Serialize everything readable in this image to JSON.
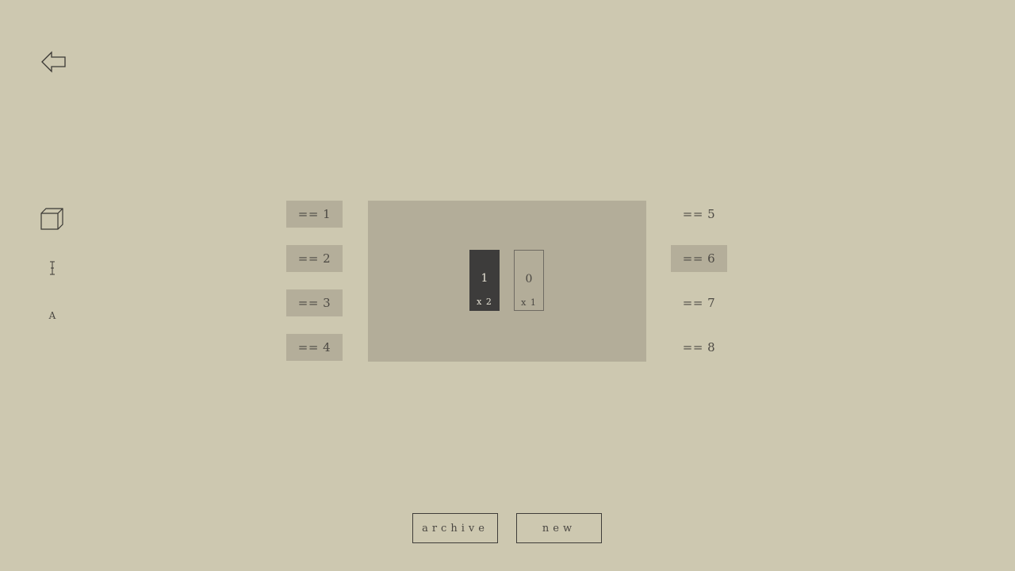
{
  "toolbar": {
    "back_icon": "back-arrow-icon",
    "cube_icon": "cube-icon",
    "cursor_icon": "text-cursor-icon",
    "letter_label": "A"
  },
  "slots_left": [
    {
      "label": "== 1",
      "filled": true
    },
    {
      "label": "== 2",
      "filled": true
    },
    {
      "label": "== 3",
      "filled": true
    },
    {
      "label": "== 4",
      "filled": true
    }
  ],
  "slots_right": [
    {
      "label": "== 5",
      "filled": false
    },
    {
      "label": "== 6",
      "filled": true
    },
    {
      "label": "== 7",
      "filled": false
    },
    {
      "label": "== 8",
      "filled": false
    }
  ],
  "cards": [
    {
      "value": "1",
      "multiplier": "x 2",
      "style": "dark"
    },
    {
      "value": "0",
      "multiplier": "x 1",
      "style": "light"
    }
  ],
  "buttons": {
    "archive_label": "archive",
    "new_label": "new"
  },
  "colors": {
    "background": "#cdc8b0",
    "slot_fill": "#b4ae9a",
    "panel": "#b3ad99",
    "dark_card": "#3d3c3b"
  }
}
